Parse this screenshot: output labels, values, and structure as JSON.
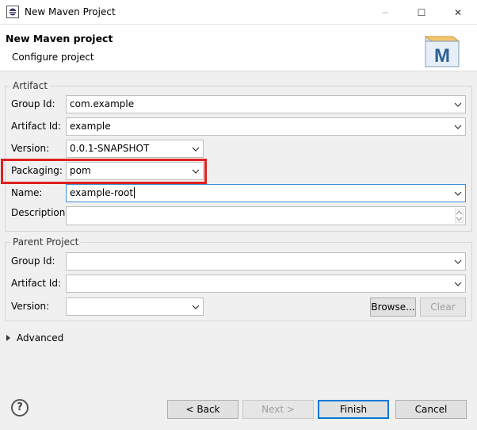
{
  "window": {
    "title": "New Maven Project",
    "controls": {
      "minimize": "─",
      "maximize": "☐",
      "close": "✕"
    }
  },
  "header": {
    "title": "New Maven project",
    "subtitle": "Configure project",
    "logo_letter": "M"
  },
  "artifact": {
    "legend": "Artifact",
    "group_id_label": "Group Id:",
    "group_id_value": "com.example",
    "artifact_id_label": "Artifact Id:",
    "artifact_id_value": "example",
    "version_label": "Version:",
    "version_value": "0.0.1-SNAPSHOT",
    "packaging_label": "Packaging:",
    "packaging_value": "pom",
    "name_label": "Name:",
    "name_value": "example-root",
    "description_label": "Description:",
    "description_value": ""
  },
  "parent": {
    "legend": "Parent Project",
    "group_id_label": "Group Id:",
    "group_id_value": "",
    "artifact_id_label": "Artifact Id:",
    "artifact_id_value": "",
    "version_label": "Version:",
    "version_value": "",
    "browse_label": "Browse...",
    "clear_label": "Clear"
  },
  "advanced": {
    "label": "Advanced"
  },
  "footer": {
    "help": "?",
    "back": "< Back",
    "next": "Next >",
    "finish": "Finish",
    "cancel": "Cancel"
  },
  "colors": {
    "highlight": "#e02020",
    "focus": "#0078d7"
  }
}
